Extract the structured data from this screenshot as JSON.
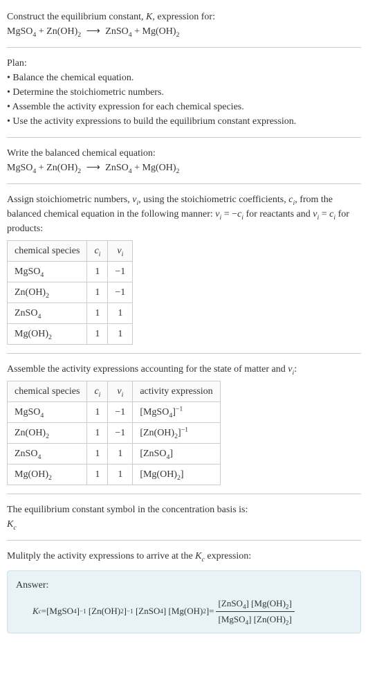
{
  "intro": {
    "line1_prefix": "Construct the equilibrium constant, ",
    "line1_var": "K",
    "line1_suffix": ", expression for:"
  },
  "equation": {
    "r1": "MgSO",
    "r1_sub": "4",
    "plus1": " + ",
    "r2": "Zn(OH)",
    "r2_sub": "2",
    "arrow": "⟶",
    "p1": "ZnSO",
    "p1_sub": "4",
    "plus2": " + ",
    "p2": "Mg(OH)",
    "p2_sub": "2"
  },
  "plan": {
    "title": "Plan:",
    "b1": "• Balance the chemical equation.",
    "b2": "• Determine the stoichiometric numbers.",
    "b3": "• Assemble the activity expression for each chemical species.",
    "b4": "• Use the activity expressions to build the equilibrium constant expression."
  },
  "balanced_label": "Write the balanced chemical equation:",
  "assign": {
    "pre": "Assign stoichiometric numbers, ",
    "vi": "ν",
    "vi_sub": "i",
    "mid1": ", using the stoichiometric coefficients, ",
    "ci": "c",
    "ci_sub": "i",
    "mid2": ", from the balanced chemical equation in the following manner: ",
    "eq_lhs": "ν",
    "eq_lhs_sub": "i",
    "eq_eq": " = −",
    "eq_rhs": "c",
    "eq_rhs_sub": "i",
    "mid3": " for reactants and ",
    "eq2_lhs": "ν",
    "eq2_lhs_sub": "i",
    "eq2_eq": " = ",
    "eq2_rhs": "c",
    "eq2_rhs_sub": "i",
    "mid4": " for products:"
  },
  "table1": {
    "h1": "chemical species",
    "h2": "c",
    "h2_sub": "i",
    "h3": "ν",
    "h3_sub": "i",
    "rows": [
      {
        "sp": "MgSO",
        "sp_sub": "4",
        "c": "1",
        "v": "−1"
      },
      {
        "sp": "Zn(OH)",
        "sp_sub": "2",
        "c": "1",
        "v": "−1"
      },
      {
        "sp": "ZnSO",
        "sp_sub": "4",
        "c": "1",
        "v": "1"
      },
      {
        "sp": "Mg(OH)",
        "sp_sub": "2",
        "c": "1",
        "v": "1"
      }
    ]
  },
  "assemble_line": {
    "pre": "Assemble the activity expressions accounting for the state of matter and ",
    "vi": "ν",
    "vi_sub": "i",
    "post": ":"
  },
  "table2": {
    "h1": "chemical species",
    "h2": "c",
    "h2_sub": "i",
    "h3": "ν",
    "h3_sub": "i",
    "h4": "activity expression",
    "rows": [
      {
        "sp": "MgSO",
        "sp_sub": "4",
        "c": "1",
        "v": "−1",
        "ae": "[MgSO",
        "ae_sub": "4",
        "ae2": "]",
        "exp": "−1"
      },
      {
        "sp": "Zn(OH)",
        "sp_sub": "2",
        "c": "1",
        "v": "−1",
        "ae": "[Zn(OH)",
        "ae_sub": "2",
        "ae2": "]",
        "exp": "−1"
      },
      {
        "sp": "ZnSO",
        "sp_sub": "4",
        "c": "1",
        "v": "1",
        "ae": "[ZnSO",
        "ae_sub": "4",
        "ae2": "]",
        "exp": ""
      },
      {
        "sp": "Mg(OH)",
        "sp_sub": "2",
        "c": "1",
        "v": "1",
        "ae": "[Mg(OH)",
        "ae_sub": "2",
        "ae2": "]",
        "exp": ""
      }
    ]
  },
  "kc_symbol": {
    "line1": "The equilibrium constant symbol in the concentration basis is:",
    "k": "K",
    "ksub": "c"
  },
  "multiply": {
    "pre": "Mulitply the activity expressions to arrive at the ",
    "k": "K",
    "ksub": "c",
    "post": " expression:"
  },
  "answer": {
    "label": "Answer:",
    "k": "K",
    "ksub": "c",
    "eq": " = ",
    "t1": "[MgSO",
    "t1_sub": "4",
    "t1c": "]",
    "t1_exp": "−1",
    "t2": "[Zn(OH)",
    "t2_sub": "2",
    "t2c": "]",
    "t2_exp": "−1",
    "t3": "[ZnSO",
    "t3_sub": "4",
    "t3c": "]",
    "t4": "[Mg(OH)",
    "t4_sub": "2",
    "t4c": "]",
    "eq2": " = ",
    "num1": "[ZnSO",
    "num1_sub": "4",
    "num1c": "] ",
    "num2": "[Mg(OH)",
    "num2_sub": "2",
    "num2c": "]",
    "den1": "[MgSO",
    "den1_sub": "4",
    "den1c": "] ",
    "den2": "[Zn(OH)",
    "den2_sub": "2",
    "den2c": "]"
  }
}
